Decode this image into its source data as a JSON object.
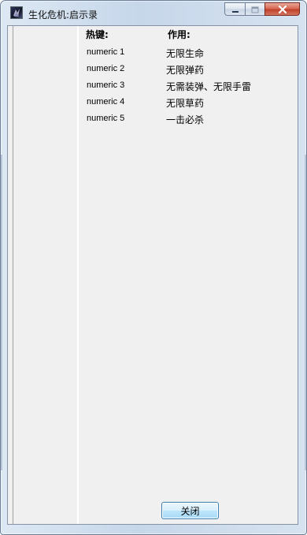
{
  "window": {
    "title": "生化危机:启示录"
  },
  "table": {
    "headers": {
      "key": "热键:",
      "action": "作用:"
    },
    "rows": [
      {
        "key": "numeric 1",
        "action": "无限生命"
      },
      {
        "key": "numeric 2",
        "action": "无限弹药"
      },
      {
        "key": "numeric 3",
        "action": "无需装弹、无限手雷"
      },
      {
        "key": "numeric 4",
        "action": "无限草药"
      },
      {
        "key": "numeric 5",
        "action": "一击必杀"
      }
    ]
  },
  "footer": {
    "close_label": "关闭"
  },
  "icons": {
    "app": "app-icon",
    "minimize": "minimize-icon",
    "maximize": "maximize-icon",
    "close": "close-icon"
  }
}
